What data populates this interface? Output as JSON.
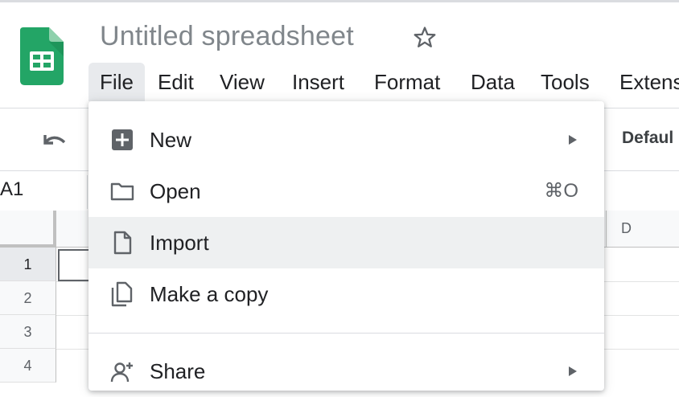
{
  "document": {
    "title": "Untitled spreadsheet"
  },
  "menubar": {
    "items": [
      {
        "label": "File",
        "active": true
      },
      {
        "label": "Edit"
      },
      {
        "label": "View"
      },
      {
        "label": "Insert"
      },
      {
        "label": "Format"
      },
      {
        "label": "Data"
      },
      {
        "label": "Tools"
      },
      {
        "label": "Extens"
      }
    ]
  },
  "toolbar": {
    "font_name": "Defaul"
  },
  "name_box": {
    "value": "A1"
  },
  "grid": {
    "visible_column": "D",
    "rows": [
      "1",
      "2",
      "3",
      "4"
    ]
  },
  "file_menu": {
    "items": [
      {
        "label": "New",
        "icon": "new-sheet-icon",
        "submenu": true
      },
      {
        "label": "Open",
        "icon": "folder-icon",
        "shortcut": "⌘O"
      },
      {
        "label": "Import",
        "icon": "file-icon",
        "highlighted": true
      },
      {
        "label": "Make a copy",
        "icon": "copy-icon"
      },
      {
        "label": "Share",
        "icon": "share-person-icon",
        "submenu": true
      }
    ]
  },
  "colors": {
    "sheets_green": "#23a566",
    "menu_active_bg": "#e8eaed",
    "menu_hover_bg": "#eef0f1",
    "title_gray": "#80868b"
  }
}
